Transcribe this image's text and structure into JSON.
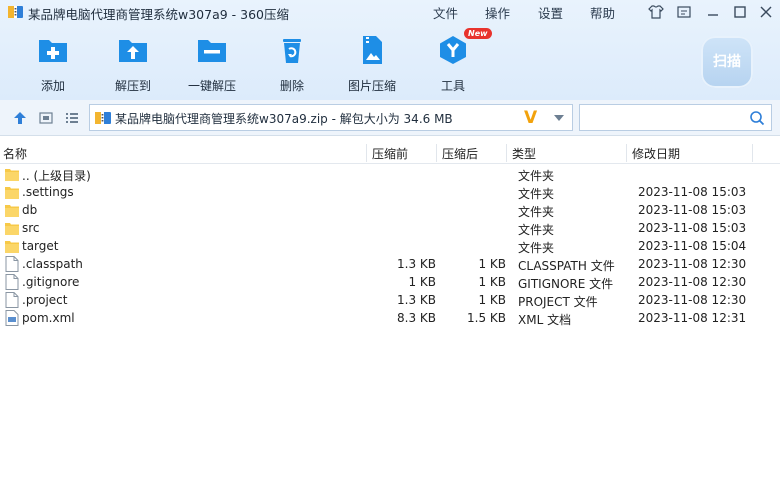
{
  "window": {
    "title": "某品牌电脑代理商管理系统w307a9 - 360压缩",
    "menu": [
      "文件",
      "操作",
      "设置",
      "帮助"
    ]
  },
  "toolbar": {
    "tools": [
      {
        "label": "添加",
        "icon": "add-icon"
      },
      {
        "label": "解压到",
        "icon": "extract-to-icon"
      },
      {
        "label": "一键解压",
        "icon": "one-click-extract-icon"
      },
      {
        "label": "删除",
        "icon": "delete-icon"
      },
      {
        "label": "图片压缩",
        "icon": "image-compress-icon"
      },
      {
        "label": "工具",
        "icon": "tools-icon"
      }
    ],
    "new_badge": "New",
    "scan_label": "扫描"
  },
  "address": {
    "path": "某品牌电脑代理商管理系统w307a9.zip - 解包大小为 34.6 MB",
    "v_mark": "V",
    "search_placeholder": ""
  },
  "columns": {
    "name": "名称",
    "size": "压缩前",
    "packed": "压缩后",
    "type": "类型",
    "mtime": "修改日期"
  },
  "files": [
    {
      "name": ".. (上级目录)",
      "size": "",
      "packed": "",
      "type": "文件夹",
      "mtime": "",
      "kind": "folder"
    },
    {
      "name": ".settings",
      "size": "",
      "packed": "",
      "type": "文件夹",
      "mtime": "2023-11-08 15:03",
      "kind": "folder"
    },
    {
      "name": "db",
      "size": "",
      "packed": "",
      "type": "文件夹",
      "mtime": "2023-11-08 15:03",
      "kind": "folder"
    },
    {
      "name": "src",
      "size": "",
      "packed": "",
      "type": "文件夹",
      "mtime": "2023-11-08 15:03",
      "kind": "folder"
    },
    {
      "name": "target",
      "size": "",
      "packed": "",
      "type": "文件夹",
      "mtime": "2023-11-08 15:04",
      "kind": "folder"
    },
    {
      "name": ".classpath",
      "size": "1.3 KB",
      "packed": "1 KB",
      "type": "CLASSPATH 文件",
      "mtime": "2023-11-08 12:30",
      "kind": "file"
    },
    {
      "name": ".gitignore",
      "size": "1 KB",
      "packed": "1 KB",
      "type": "GITIGNORE 文件",
      "mtime": "2023-11-08 12:30",
      "kind": "file"
    },
    {
      "name": ".project",
      "size": "1.3 KB",
      "packed": "1 KB",
      "type": "PROJECT 文件",
      "mtime": "2023-11-08 12:30",
      "kind": "file"
    },
    {
      "name": "pom.xml",
      "size": "8.3 KB",
      "packed": "1.5 KB",
      "type": "XML 文档",
      "mtime": "2023-11-08 12:31",
      "kind": "xml"
    }
  ],
  "colors": {
    "accent": "#1e8ee6",
    "folder": "#f7c948",
    "toolbar_bg": "#dcebfb"
  }
}
